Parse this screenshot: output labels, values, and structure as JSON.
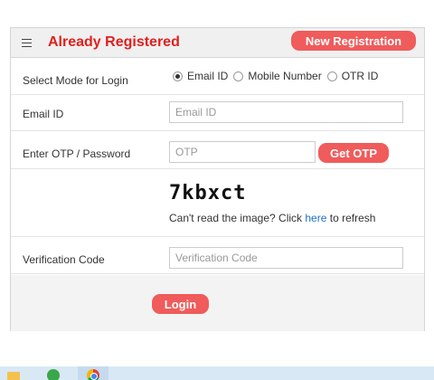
{
  "header": {
    "title": "Already Registered",
    "new_registration_label": "New Registration",
    "menu_icon": "hamburger-icon"
  },
  "login_mode": {
    "label": "Select Mode for Login",
    "options": [
      "Email ID",
      "Mobile Number",
      "OTR ID"
    ],
    "selected": "Email ID"
  },
  "email": {
    "label": "Email ID",
    "placeholder": "Email ID",
    "value": ""
  },
  "otp": {
    "label": "Enter OTP / Password",
    "placeholder": "OTP",
    "value": "",
    "get_otp_label": "Get OTP"
  },
  "captcha": {
    "text": "7kbxct",
    "refresh_prefix": "Can't read the image? Click ",
    "refresh_link": "here",
    "refresh_suffix": " to refresh"
  },
  "verification": {
    "label": "Verification Code",
    "placeholder": "Verification Code",
    "value": ""
  },
  "login_label": "Login",
  "colors": {
    "accent": "#f05b5b",
    "title": "#e0201f",
    "link": "#2070c8"
  },
  "taskbar": {
    "icons": [
      "file-explorer-icon",
      "green-app-icon",
      "chrome-icon"
    ]
  }
}
